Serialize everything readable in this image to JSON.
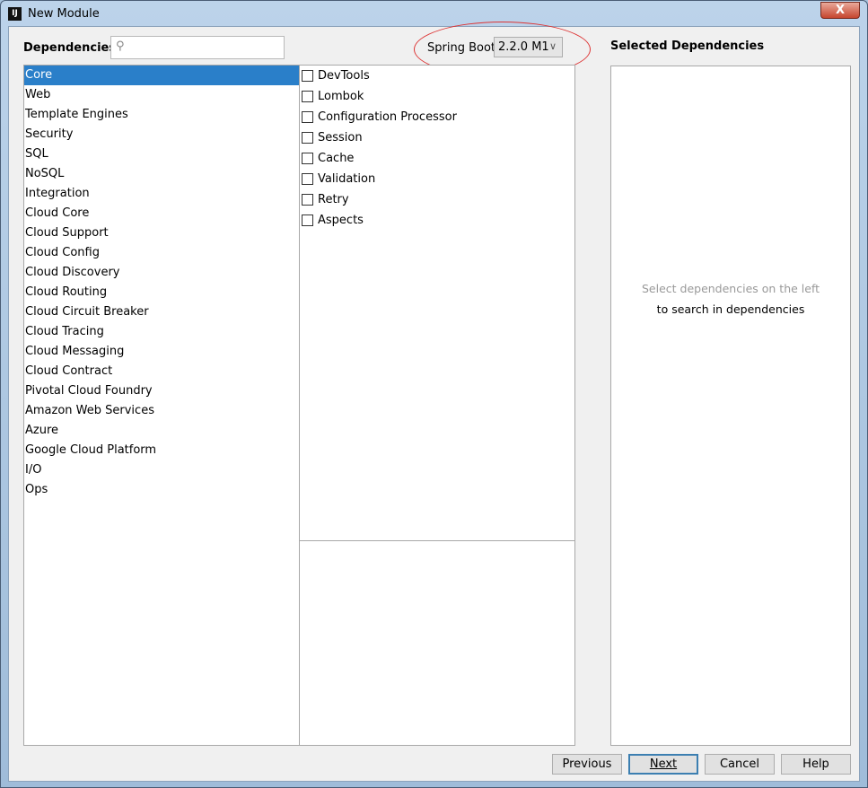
{
  "window": {
    "title": "New Module",
    "close_label": "X",
    "app_icon": "IJ"
  },
  "dependencies_label": "Dependencies",
  "search": {
    "value": "",
    "icon": "search-icon"
  },
  "spring_boot": {
    "label": "Spring Boot",
    "version": "2.2.0 M1"
  },
  "selected_label": "Selected Dependencies",
  "categories": [
    "Core",
    "Web",
    "Template Engines",
    "Security",
    "SQL",
    "NoSQL",
    "Integration",
    "Cloud Core",
    "Cloud Support",
    "Cloud Config",
    "Cloud Discovery",
    "Cloud Routing",
    "Cloud Circuit Breaker",
    "Cloud Tracing",
    "Cloud Messaging",
    "Cloud Contract",
    "Pivotal Cloud Foundry",
    "Amazon Web Services",
    "Azure",
    "Google Cloud Platform",
    "I/O",
    "Ops"
  ],
  "selected_category": "Core",
  "deps": [
    "DevTools",
    "Lombok",
    "Configuration Processor",
    "Session",
    "Cache",
    "Validation",
    "Retry",
    "Aspects"
  ],
  "hint": {
    "line1": "Select dependencies on the left",
    "line2": "to search in dependencies"
  },
  "buttons": {
    "previous": "Previous",
    "next": "Next",
    "cancel": "Cancel",
    "help": "Help"
  }
}
